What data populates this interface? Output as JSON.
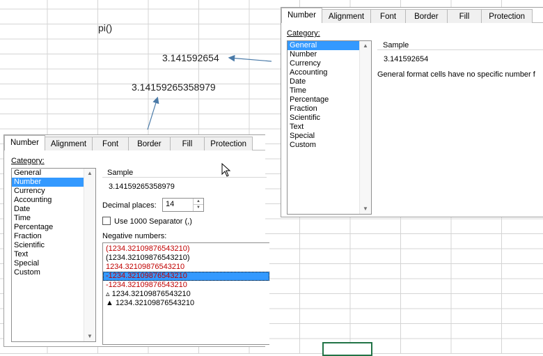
{
  "sheet": {
    "cells": {
      "formula": "pi()",
      "value_short": "3.141592654",
      "value_long": "3.14159265358979"
    }
  },
  "dialog_right": {
    "tabs": [
      "Number",
      "Alignment",
      "Font",
      "Border",
      "Fill",
      "Protection"
    ],
    "active_tab": "Number",
    "category_label": "Category:",
    "categories": [
      "General",
      "Number",
      "Currency",
      "Accounting",
      "Date",
      "Time",
      "Percentage",
      "Fraction",
      "Scientific",
      "Text",
      "Special",
      "Custom"
    ],
    "selected_category": "General",
    "sample_label": "Sample",
    "sample_value": "3.141592654",
    "description": "General format cells have no specific number f"
  },
  "dialog_left": {
    "tabs": [
      "Number",
      "Alignment",
      "Font",
      "Border",
      "Fill",
      "Protection"
    ],
    "active_tab": "Number",
    "category_label": "Category:",
    "categories": [
      "General",
      "Number",
      "Currency",
      "Accounting",
      "Date",
      "Time",
      "Percentage",
      "Fraction",
      "Scientific",
      "Text",
      "Special",
      "Custom"
    ],
    "selected_category": "Number",
    "sample_label": "Sample",
    "sample_value": "3.14159265358979",
    "decimal_label": "Decimal places:",
    "decimal_value": "14",
    "separator_label": "Use 1000 Separator (,)",
    "negative_label": "Negative numbers:",
    "negatives": [
      {
        "text": "(1234.32109876543210)",
        "style": "red"
      },
      {
        "text": "(1234.32109876543210)",
        "style": "black"
      },
      {
        "text": "1234.32109876543210",
        "style": "red"
      },
      {
        "text": "-1234.32109876543210",
        "style": "selected"
      },
      {
        "text": "-1234.32109876543210",
        "style": "red"
      },
      {
        "text": "▵ 1234.32109876543210",
        "style": "black"
      },
      {
        "text": "▲ 1234.32109876543210",
        "style": "black"
      }
    ]
  },
  "colors": {
    "selection": "#3399ff",
    "negative_red": "#c00000",
    "arrow": "#4a7aa8",
    "active_cell_border": "#217346"
  }
}
